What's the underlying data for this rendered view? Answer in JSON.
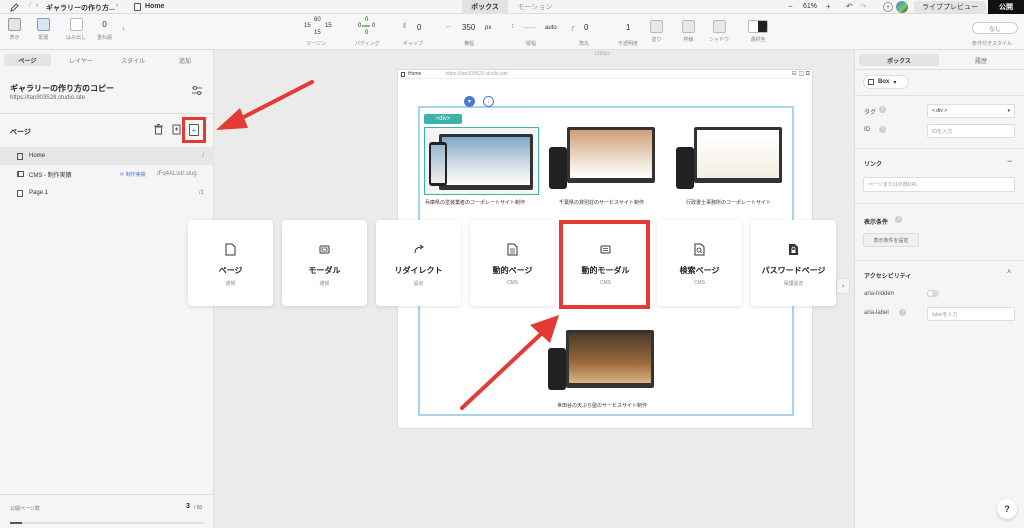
{
  "topbar": {
    "breadcrumb_project": "ギャラリーの作り方...",
    "breadcrumb_page": "Home",
    "tabs": [
      "ボックス",
      "モーション"
    ],
    "zoom": "61%",
    "live_preview": "ライブプレビュー",
    "publish": "公開"
  },
  "toolbar": {
    "show": "表示",
    "layout": "配置",
    "overflow": "はみ出し",
    "stack_value": "0",
    "stack": "重ね順",
    "margin_top": "60",
    "margin_left": "15",
    "margin_right": "15",
    "margin_bottom": "15",
    "margin": "マージン",
    "pad_top": "0",
    "pad_left": "0",
    "pad_right": "0",
    "pad_bottom": "0",
    "padding": "パディング",
    "gap_value": "0",
    "gap": "ギャップ",
    "width_value": "350",
    "width_unit": "px",
    "width": "横幅",
    "height_value": "-----",
    "height_unit": "auto",
    "height": "縦幅",
    "radius_value": "0",
    "radius": "角丸",
    "opacity_value": "1",
    "opacity": "不透明度",
    "blur": "塗り",
    "border": "枠線",
    "shadow": "シャドウ",
    "color": "選択色",
    "none": "なし",
    "conditional_style": "条件付きスタイル"
  },
  "left": {
    "tabs": [
      "ページ",
      "レイヤー",
      "スタイル",
      "追加"
    ],
    "project_title": "ギャラリーの作り方のコピー",
    "project_url": "https://tan903528.studio.site",
    "pages_header": "ページ",
    "pages": [
      {
        "name": "Home",
        "slug": "/",
        "badge": ""
      },
      {
        "name": "CMS - 制作実績",
        "slug": "/Fq4AList/:slug",
        "badge": "制作実績"
      },
      {
        "name": "Page 1",
        "slug": "/1",
        "badge": ""
      }
    ],
    "footer_label": "公開ページ数",
    "footer_count": "3",
    "footer_total": "/ 50"
  },
  "canvas": {
    "width_label": "1280px",
    "frame_page": "Home",
    "frame_url": "https://tan903528.studio.site",
    "selection_tag": "<div>",
    "captions": [
      "兵庫県の塗装業者のコーポレートサイト制作",
      "千葉県の貸別荘のサービスサイト制作",
      "行政書士事務所のコーポレートサイト",
      "世田谷の天ぷら屋のサービスサイト制作"
    ]
  },
  "popup": {
    "items": [
      {
        "title": "ページ",
        "sub": "通常",
        "icon": "page-icon"
      },
      {
        "title": "モーダル",
        "sub": "通常",
        "icon": "modal-icon"
      },
      {
        "title": "リダイレクト",
        "sub": "設定",
        "icon": "redirect-icon"
      },
      {
        "title": "動的ページ",
        "sub": "CMS",
        "icon": "dynamic-page-icon"
      },
      {
        "title": "動的モーダル",
        "sub": "CMS",
        "icon": "dynamic-modal-icon"
      },
      {
        "title": "検索ページ",
        "sub": "CMS",
        "icon": "search-page-icon"
      },
      {
        "title": "パスワードページ",
        "sub": "保護設定",
        "icon": "lock-icon"
      }
    ]
  },
  "right": {
    "tabs": [
      "ボックス",
      "履歴"
    ],
    "element_type": "Box",
    "tag_label": "タグ",
    "tag_value": "< div >",
    "id_label": "ID",
    "id_placeholder": "IDを入力",
    "link_header": "リンク",
    "link_placeholder": "ページまたは外部URL",
    "display_header": "表示条件",
    "display_button": "表示条件を設定",
    "a11y_header": "アクセシビリティ",
    "aria_hidden": "aria-hidden",
    "aria_label": "aria-label",
    "aria_label_placeholder": "labelを入力",
    "help": "?"
  },
  "colors": {
    "annotation_red": "#e53935",
    "accent_blue": "#4a7bd0",
    "selection_teal": "#3bb3a8"
  }
}
